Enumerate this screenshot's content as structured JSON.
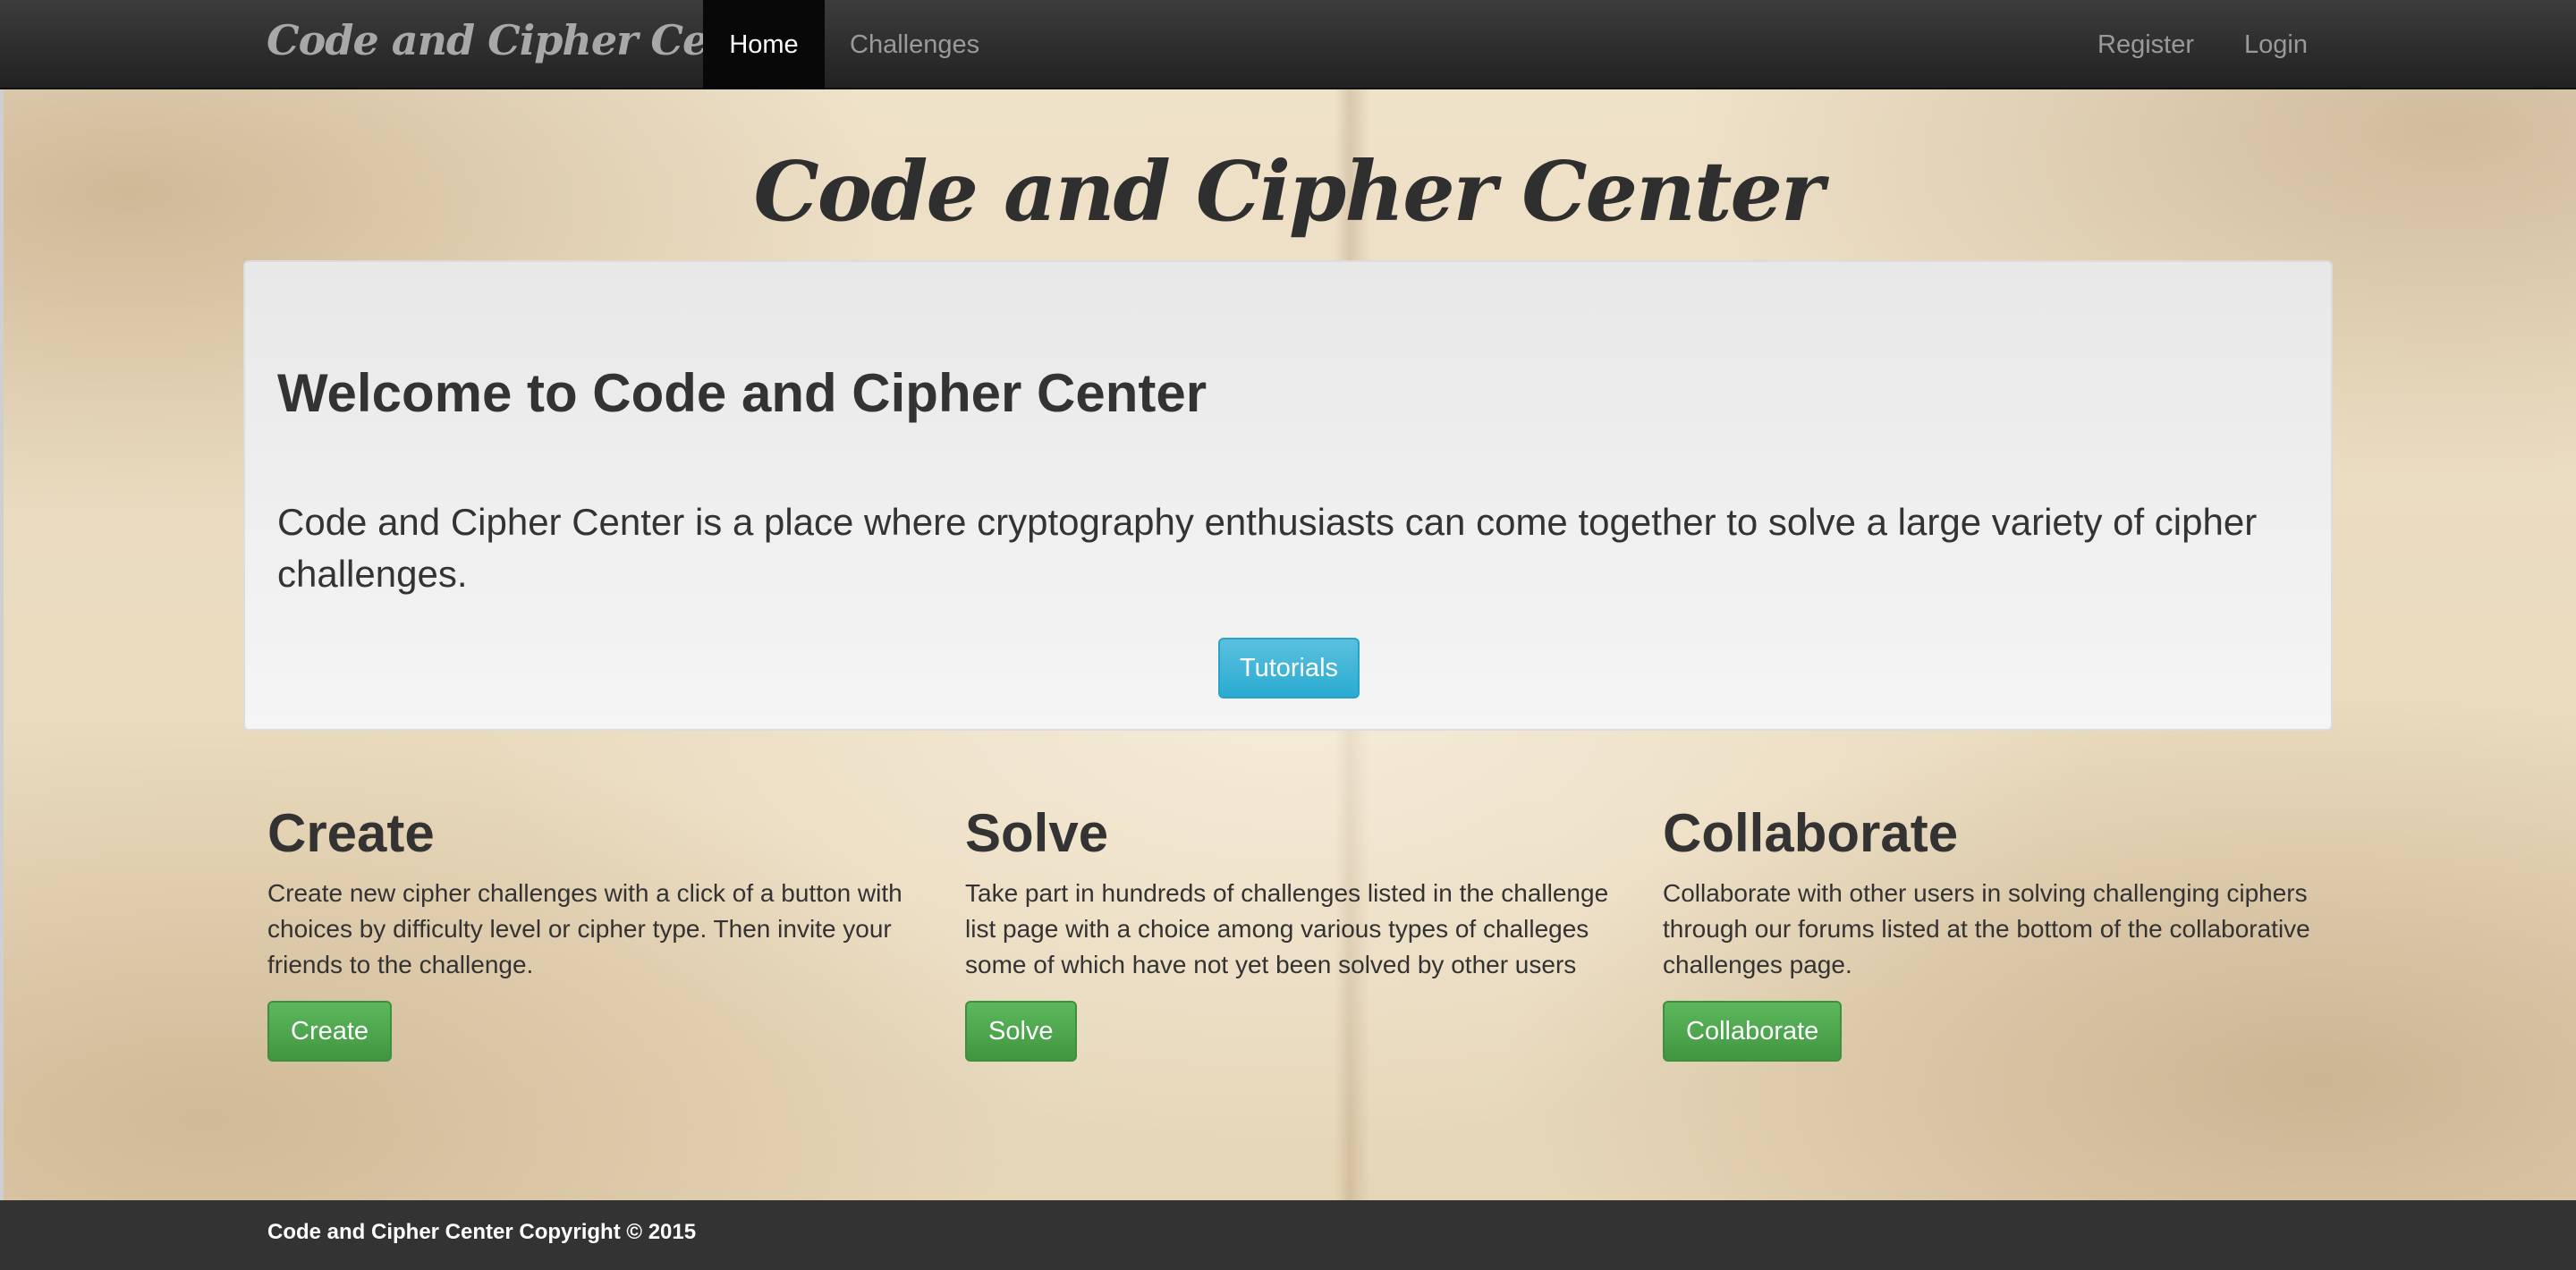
{
  "navbar": {
    "brand": "Code and Cipher Center",
    "items": [
      {
        "label": "Home",
        "active": true
      },
      {
        "label": "Challenges",
        "active": false
      }
    ],
    "right_items": [
      {
        "label": "Register"
      },
      {
        "label": "Login"
      }
    ]
  },
  "hero": {
    "title": "Code and Cipher Center"
  },
  "jumbotron": {
    "heading": "Welcome to Code and Cipher Center",
    "text": "Code and Cipher Center is a place where cryptography enthusiasts can come together to solve a large variety of cipher challenges.",
    "button_label": "Tutorials"
  },
  "features": [
    {
      "heading": "Create",
      "text": "Create new cipher challenges with a click of a button with choices by difficulty level or cipher type. Then invite your friends to the challenge.",
      "button_label": "Create"
    },
    {
      "heading": "Solve",
      "text": "Take part in hundreds of challenges listed in the challenge list page with a choice among various types of challeges some of which have not yet been solved by other users",
      "button_label": "Solve"
    },
    {
      "heading": "Collaborate",
      "text": "Collaborate with other users in solving challenging ciphers through our forums listed at the bottom of the collaborative challenges page.",
      "button_label": "Collaborate"
    }
  ],
  "footer": {
    "text": "Code and Cipher Center Copyright © 2015"
  },
  "colors": {
    "navbar_bg": "#222222",
    "info_button": "#5bc0de",
    "success_button": "#5cb85c",
    "footer_bg": "#333333"
  }
}
